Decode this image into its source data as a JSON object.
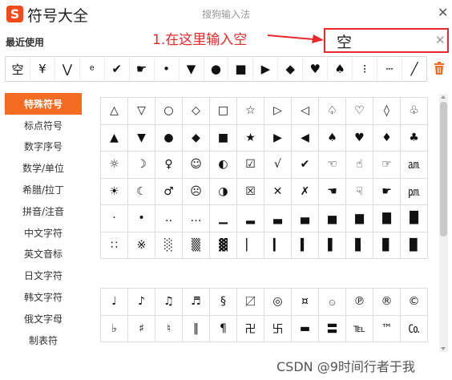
{
  "app": {
    "logo_letter": "S",
    "title": "符号大全",
    "subtitle": "搜狗输入法",
    "close_glyph": "✕"
  },
  "recent": {
    "label": "最近使用",
    "symbols": [
      "空",
      "¥",
      "⋁",
      "ͤ",
      "✔",
      "☛",
      "•",
      "▼",
      "●",
      "■",
      "▶",
      "◆",
      "♥",
      "♠",
      "⁝",
      "┄",
      "╱"
    ]
  },
  "annotation": {
    "text": "1.在这里输入空",
    "color": "#e8282a"
  },
  "search": {
    "value": "空",
    "clear_glyph": "✕"
  },
  "sidebar": {
    "items": [
      {
        "label": "特殊符号",
        "active": true
      },
      {
        "label": "标点符号",
        "active": false
      },
      {
        "label": "数字序号",
        "active": false
      },
      {
        "label": "数学/单位",
        "active": false
      },
      {
        "label": "希腊/拉丁",
        "active": false
      },
      {
        "label": "拼音/注音",
        "active": false
      },
      {
        "label": "中文字符",
        "active": false
      },
      {
        "label": "英文音标",
        "active": false
      },
      {
        "label": "日文字符",
        "active": false
      },
      {
        "label": "韩文字符",
        "active": false
      },
      {
        "label": "俄文字母",
        "active": false
      },
      {
        "label": "制表符",
        "active": false
      }
    ]
  },
  "grid1": {
    "rows": [
      [
        "△",
        "▽",
        "○",
        "◇",
        "□",
        "☆",
        "▷",
        "◁",
        "♤",
        "♡",
        "◊",
        "♧"
      ],
      [
        "▲",
        "▼",
        "●",
        "◆",
        "■",
        "★",
        "▶",
        "◀",
        "♠",
        "♥",
        "♦",
        "♣"
      ],
      [
        "☼",
        "☽",
        "♀",
        "☺",
        "◐",
        "☑",
        "√",
        "✔",
        "☜",
        "☝",
        "☞",
        "㏂"
      ],
      [
        "☀",
        "☾",
        "♂",
        "☹",
        "◑",
        "☒",
        "✕",
        "✗",
        "☚",
        "☟",
        "☛",
        "㏘"
      ],
      [
        "·",
        "•",
        "‥",
        "…",
        "▁",
        "▂",
        "▃",
        "▄",
        "▅",
        "▆",
        "▇",
        "█"
      ],
      [
        "∷",
        "※",
        "░",
        "▒",
        "▓",
        "▏",
        "▎",
        "▍",
        "▌",
        "▋",
        "▊",
        "▉"
      ]
    ]
  },
  "grid2": {
    "rows": [
      [
        "♩",
        "♪",
        "♫",
        "♬",
        "§",
        "〼",
        "◎",
        "¤",
        "۞",
        "℗",
        "®",
        "©"
      ],
      [
        "♭",
        "♯",
        "♮",
        "‖",
        "¶",
        "卍",
        "卐",
        "▬",
        "〓",
        "℡",
        "™",
        "㏇"
      ]
    ]
  },
  "watermark": "CSDN @9时间行者于我"
}
